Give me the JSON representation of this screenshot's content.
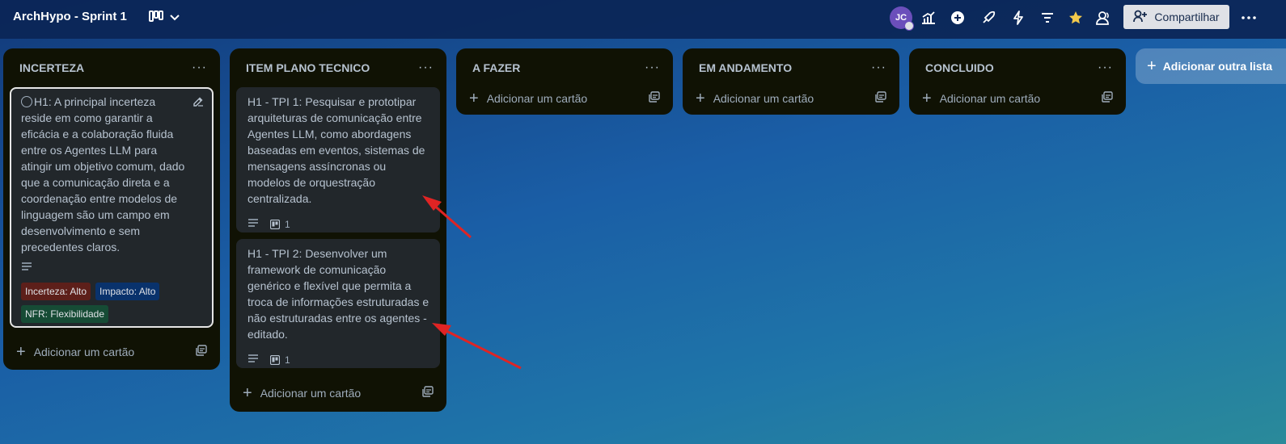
{
  "header": {
    "board_title": "ArchHypo - Sprint 1",
    "avatar_initials": "JC",
    "share_label": "Compartilhar",
    "icons": [
      "board-view-icon",
      "chevron-down-icon",
      "dashboard-icon",
      "plus-circle-icon",
      "power-ups-icon",
      "automation-icon",
      "filter-icon",
      "star-icon",
      "visibility-icon",
      "more-icon"
    ]
  },
  "lists": [
    {
      "title": "INCERTEZA",
      "menu": "···",
      "add_card_label": "Adicionar um cartão",
      "cards": [
        {
          "text": "H1: A principal incerteza reside em como garantir a eficácia e a colaboração fluida entre os Agentes LLM para atingir um objetivo comum, dado que a comunicação direta e a coordenação entre modelos de linguagem são um campo em desenvolvimento e sem precedentes claros.",
          "labels": [
            {
              "text": "Incerteza: Alto",
              "color": "#5d1f1a"
            },
            {
              "text": "Impacto: Alto",
              "color": "#09326c"
            },
            {
              "text": "NFR: Flexibilidade",
              "color": "#164b35"
            }
          ]
        }
      ]
    },
    {
      "title": "ITEM PLANO TECNICO",
      "menu": "···",
      "add_card_label": "Adicionar um cartão",
      "cards": [
        {
          "text": "H1 - TPI 1: Pesquisar e prototipar arquiteturas de comunicação entre Agentes LLM, como abordagens baseadas em eventos, sistemas de mensagens assíncronas ou modelos de orquestração centralizada.",
          "board_count": "1"
        },
        {
          "text": "H1 - TPI 2: Desenvolver um framework de comunicação genérico e flexível que permita a troca de informações estruturadas e não estruturadas entre os agentes - editado.",
          "board_count": "1"
        }
      ]
    },
    {
      "title": "A FAZER",
      "menu": "···",
      "add_card_label": "Adicionar um cartão"
    },
    {
      "title": "EM ANDAMENTO",
      "menu": "···",
      "add_card_label": "Adicionar um cartão"
    },
    {
      "title": "CONCLUIDO",
      "menu": "···",
      "add_card_label": "Adicionar um cartão"
    }
  ],
  "add_list_label": "Adicionar outra lista",
  "colors": {
    "list_bg": "#101204",
    "card_bg": "#22272b",
    "star": "#f2c94c",
    "arrow": "#e02424"
  }
}
